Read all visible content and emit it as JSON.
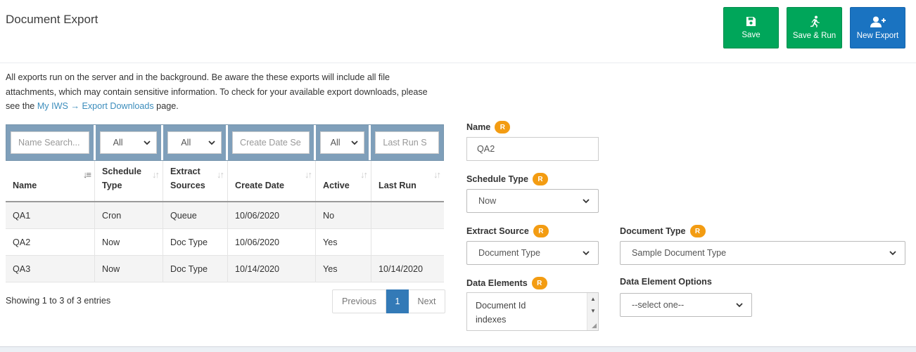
{
  "header": {
    "title": "Document Export",
    "buttons": {
      "save": "Save",
      "save_run": "Save & Run",
      "new_export": "New Export"
    }
  },
  "intro": {
    "text_before": "All exports run on the server and in the background. Be aware the these exports will include all file attachments, which may contain sensitive information. To check for your available export downloads, please see the ",
    "link": "My IWS → Export Downloads",
    "text_after": " page."
  },
  "table": {
    "filters": {
      "name_placeholder": "Name Search...",
      "schedule": "All",
      "extract": "All",
      "create_date_placeholder": "Create Date Se",
      "active": "All",
      "last_run_placeholder": "Last Run S"
    },
    "columns": [
      [
        "Name"
      ],
      [
        "Schedule",
        "Type"
      ],
      [
        "Extract",
        "Sources"
      ],
      [
        "Create Date"
      ],
      [
        "Active"
      ],
      [
        "Last Run"
      ]
    ],
    "rows": [
      [
        "QA1",
        "Cron",
        "Queue",
        "10/06/2020",
        "No",
        ""
      ],
      [
        "QA2",
        "Now",
        "Doc Type",
        "10/06/2020",
        "Yes",
        ""
      ],
      [
        "QA3",
        "Now",
        "Doc Type",
        "10/14/2020",
        "Yes",
        "10/14/2020"
      ]
    ],
    "showing": "Showing 1 to 3 of 3 entries",
    "pagination": {
      "previous": "Previous",
      "current": "1",
      "next": "Next"
    }
  },
  "form": {
    "required_badge": "R",
    "name": {
      "label": "Name",
      "value": "QA2"
    },
    "schedule_type": {
      "label": "Schedule Type",
      "value": "Now"
    },
    "extract_source": {
      "label": "Extract Source",
      "value": "Document Type"
    },
    "document_type": {
      "label": "Document Type",
      "value": "Sample Document Type"
    },
    "data_elements": {
      "label": "Data Elements",
      "items": [
        "Document Id",
        "indexes"
      ]
    },
    "data_element_options": {
      "label": "Data Element Options",
      "value": "--select one--"
    }
  },
  "colors": {
    "green": "#00a65a",
    "blue": "#1a73c1",
    "filter_bar": "#7f9fba",
    "badge": "#f39c12",
    "link": "#3c8dbc",
    "page_active": "#337ab7"
  }
}
